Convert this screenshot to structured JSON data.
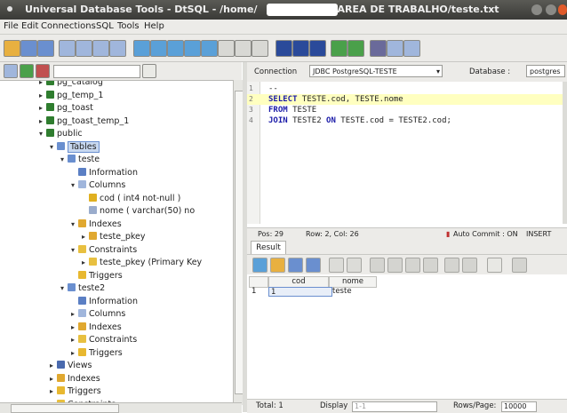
{
  "window": {
    "title_prefix": "Universal Database Tools - DtSQL - /home/",
    "title_suffix": "/AREA DE TRABALHO/teste.txt"
  },
  "menu": [
    "File",
    "Edit",
    "Connections",
    "SQL",
    "Tools",
    "Help"
  ],
  "tree": [
    {
      "label": "pg_catalog",
      "indent": 3,
      "exp": "▸",
      "icon": "schema-icon",
      "color": "#2f7d2f"
    },
    {
      "label": "pg_temp_1",
      "indent": 3,
      "exp": "▸",
      "icon": "schema-icon",
      "color": "#2f7d2f"
    },
    {
      "label": "pg_toast",
      "indent": 3,
      "exp": "▸",
      "icon": "schema-icon",
      "color": "#2f7d2f"
    },
    {
      "label": "pg_toast_temp_1",
      "indent": 3,
      "exp": "▸",
      "icon": "schema-icon",
      "color": "#2f7d2f"
    },
    {
      "label": "public",
      "indent": 3,
      "exp": "▾",
      "icon": "schema-icon",
      "color": "#2f7d2f"
    },
    {
      "label": "Tables",
      "indent": 4,
      "exp": "▾",
      "icon": "folder-icon",
      "color": "#6a8fcf",
      "selected": true
    },
    {
      "label": "teste",
      "indent": 5,
      "exp": "▾",
      "icon": "table-icon",
      "color": "#6a8fcf"
    },
    {
      "label": "Information",
      "indent": 6,
      "exp": "",
      "icon": "info-icon",
      "color": "#5b7fc4"
    },
    {
      "label": "Columns",
      "indent": 6,
      "exp": "▾",
      "icon": "columns-icon",
      "color": "#a0b6dc"
    },
    {
      "label": "cod  ( int4  not-null  )",
      "indent": 7,
      "exp": "",
      "icon": "key-icon",
      "color": "#e0b020"
    },
    {
      "label": "nome  ( varchar(50)  no",
      "indent": 7,
      "exp": "",
      "icon": "column-icon",
      "color": "#9aaccc"
    },
    {
      "label": "Indexes",
      "indent": 6,
      "exp": "▾",
      "icon": "indexes-icon",
      "color": "#e0a830"
    },
    {
      "label": "teste_pkey",
      "indent": 7,
      "exp": "▸",
      "icon": "index-icon",
      "color": "#e0a830"
    },
    {
      "label": "Constraints",
      "indent": 6,
      "exp": "▾",
      "icon": "constraints-icon",
      "color": "#e8c040"
    },
    {
      "label": "teste_pkey  (Primary Key",
      "indent": 7,
      "exp": "▸",
      "icon": "constraint-icon",
      "color": "#e8c040"
    },
    {
      "label": "Triggers",
      "indent": 6,
      "exp": "",
      "icon": "trigger-icon",
      "color": "#e8b830"
    },
    {
      "label": "teste2",
      "indent": 5,
      "exp": "▾",
      "icon": "table-icon",
      "color": "#6a8fcf"
    },
    {
      "label": "Information",
      "indent": 6,
      "exp": "",
      "icon": "info-icon",
      "color": "#5b7fc4"
    },
    {
      "label": "Columns",
      "indent": 6,
      "exp": "▸",
      "icon": "columns-icon",
      "color": "#a0b6dc"
    },
    {
      "label": "Indexes",
      "indent": 6,
      "exp": "▸",
      "icon": "indexes-icon",
      "color": "#e0a830"
    },
    {
      "label": "Constraints",
      "indent": 6,
      "exp": "▸",
      "icon": "constraints-icon",
      "color": "#e8c040"
    },
    {
      "label": "Triggers",
      "indent": 6,
      "exp": "▸",
      "icon": "trigger-icon",
      "color": "#e8b830"
    },
    {
      "label": "Views",
      "indent": 4,
      "exp": "▸",
      "icon": "views-icon",
      "color": "#4a6aae"
    },
    {
      "label": "Indexes",
      "indent": 4,
      "exp": "▸",
      "icon": "indexes-icon",
      "color": "#e0a830"
    },
    {
      "label": "Triggers",
      "indent": 4,
      "exp": "▸",
      "icon": "trigger-icon",
      "color": "#e8b830"
    },
    {
      "label": "Constraints",
      "indent": 4,
      "exp": "▸",
      "icon": "constraints-icon",
      "color": "#e8c040"
    }
  ],
  "connection": {
    "label": "Connection",
    "value": "JDBC PostgreSQL-TESTE",
    "db_label": "Database :",
    "db_value": "postgres"
  },
  "editor": {
    "lines": [
      {
        "n": "1",
        "parts": [
          {
            "t": "--",
            "kw": false
          }
        ]
      },
      {
        "n": "2",
        "parts": [
          {
            "t": "SELECT",
            "kw": true
          },
          {
            "t": " TESTE.cod, TESTE.nome",
            "kw": false
          }
        ],
        "highlight": true
      },
      {
        "n": "3",
        "parts": [
          {
            "t": "FROM",
            "kw": true
          },
          {
            "t": " TESTE",
            "kw": false
          }
        ]
      },
      {
        "n": "4",
        "parts": [
          {
            "t": "JOIN",
            "kw": true
          },
          {
            "t": " TESTE2 ",
            "kw": false
          },
          {
            "t": "ON",
            "kw": true
          },
          {
            "t": " TESTE.cod = TESTE2.cod;",
            "kw": false
          }
        ]
      }
    ]
  },
  "status": {
    "pos": "Pos: 29",
    "rowcol": "Row: 2, Col: 26",
    "autocommit": "Auto Commit : ON",
    "mode": "INSERT"
  },
  "result": {
    "tab": "Result",
    "columns": [
      "cod",
      "nome"
    ],
    "rows": [
      [
        "1",
        "1",
        "teste"
      ]
    ]
  },
  "bottom": {
    "total": "Total: 1",
    "display_label": "Display",
    "display_value": "1-1",
    "rows_label": "Rows/Page:",
    "rows_value": "10000"
  },
  "colors": {
    "highlight": "#ffffc0",
    "keyword": "#1a1aa8",
    "selection": "#c8d8f0"
  }
}
